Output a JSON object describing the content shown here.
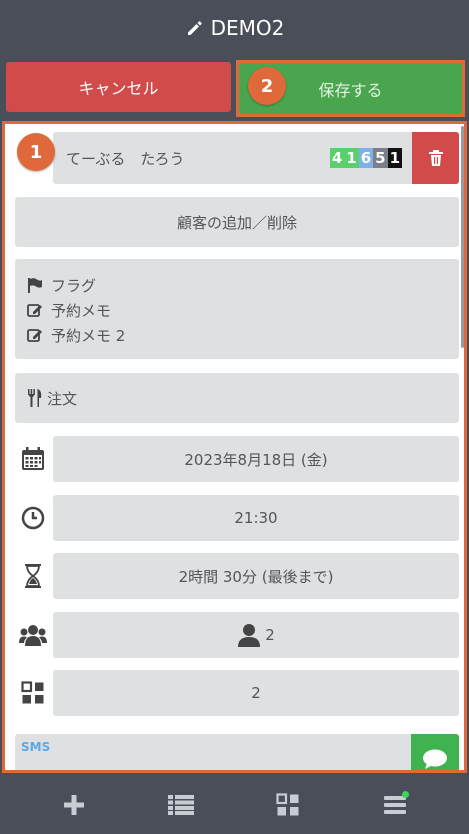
{
  "header": {
    "title": "DEMO2",
    "icon": "pencil-icon"
  },
  "actions": {
    "cancel_label": "キャンセル",
    "save_label": "保存する",
    "save_badge": "2"
  },
  "panel": {
    "badge": "1",
    "table": {
      "name": "てーぶる　たろう",
      "numbers": [
        {
          "text": "4",
          "color": "#5ad06a"
        },
        {
          "text": "1",
          "color": "#5ad06a"
        },
        {
          "text": "6",
          "color": "#7fb0e6"
        },
        {
          "text": "5",
          "color": "#7a7f8a"
        },
        {
          "text": "1",
          "color": "#111111"
        }
      ]
    },
    "add_customer_label": "顧客の追加／削除",
    "memos": [
      {
        "icon": "flag-icon",
        "label": "フラグ"
      },
      {
        "icon": "edit-icon",
        "label": "予約メモ"
      },
      {
        "icon": "edit-icon",
        "label": "予約メモ 2"
      }
    ],
    "order_label": "注文",
    "date": "2023年8月18日 (金)",
    "time": "21:30",
    "duration": "2時間 30分 (最後まで)",
    "guests": "2",
    "tables": "2",
    "sms_label": "SMS"
  },
  "colors": {
    "accent": "#e0693b",
    "danger": "#d14b4b",
    "success": "#4aa64e",
    "bg": "#4a4e59"
  }
}
